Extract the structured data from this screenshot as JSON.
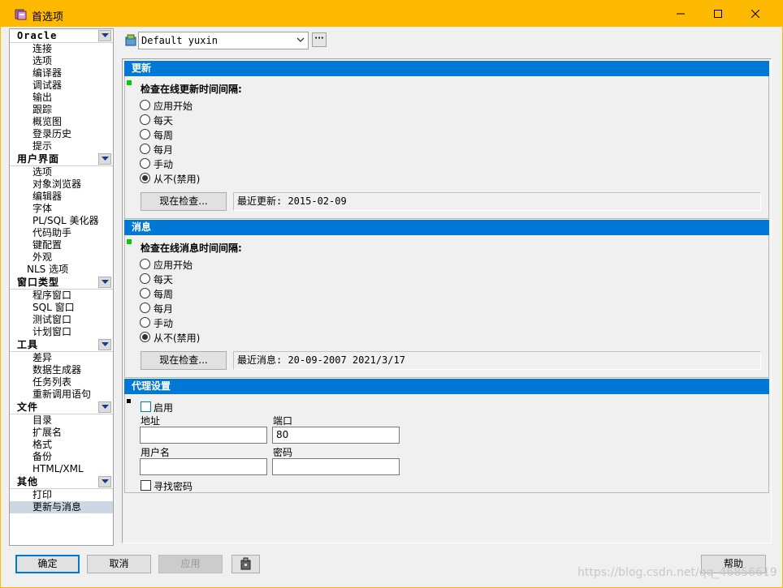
{
  "window": {
    "title": "首选项"
  },
  "sidebar": {
    "categories": [
      {
        "name": "Oracle",
        "items": [
          "连接",
          "选项",
          "编译器",
          "调试器",
          "输出",
          "跟踪",
          "概览图",
          "登录历史",
          "提示"
        ]
      },
      {
        "name": "用户界面",
        "items": [
          "选项",
          "对象浏览器",
          "编辑器",
          "字体",
          "PL/SQL 美化器",
          "代码助手",
          "键配置",
          "外观",
          "NLS 选项"
        ]
      },
      {
        "name": "窗口类型",
        "items": [
          "程序窗口",
          "SQL 窗口",
          "测试窗口",
          "计划窗口"
        ]
      },
      {
        "name": "工具",
        "items": [
          "差异",
          "数据生成器",
          "任务列表",
          "重新调用语句"
        ]
      },
      {
        "name": "文件",
        "items": [
          "目录",
          "扩展名",
          "格式",
          "备份",
          "HTML/XML"
        ]
      },
      {
        "name": "其他",
        "items": [
          "打印",
          "更新与消息"
        ]
      }
    ],
    "selected": "更新与消息"
  },
  "profile": {
    "value": "Default yuxin",
    "more_label": "···"
  },
  "update": {
    "header": "更新",
    "prompt": "检查在线更新时间间隔:",
    "options": [
      "应用开始",
      "每天",
      "每周",
      "每月",
      "手动",
      "从不(禁用)"
    ],
    "selected_index": 5,
    "check_button": "现在检查...",
    "status": "最近更新: 2015-02-09"
  },
  "messages": {
    "header": "消息",
    "prompt": "检查在线消息时间间隔:",
    "options": [
      "应用开始",
      "每天",
      "每周",
      "每月",
      "手动",
      "从不(禁用)"
    ],
    "selected_index": 5,
    "check_button": "现在检查...",
    "status": "最近消息: 20-09-2007 2021/3/17"
  },
  "proxy": {
    "header": "代理设置",
    "enable_label": "启用",
    "address_label": "地址",
    "address_value": "",
    "port_label": "端口",
    "port_value": "80",
    "username_label": "用户名",
    "username_value": "",
    "password_label": "密码",
    "password_value": "",
    "find_password_label": "寻找密码"
  },
  "footer": {
    "ok": "确定",
    "cancel": "取消",
    "apply": "应用",
    "help": "帮助"
  },
  "watermark": "https://blog.csdn.net/qq_46856619",
  "colors": {
    "titlebar": "#ffb900",
    "section_header": "#0078d7",
    "selection": "#ccd7e4"
  }
}
